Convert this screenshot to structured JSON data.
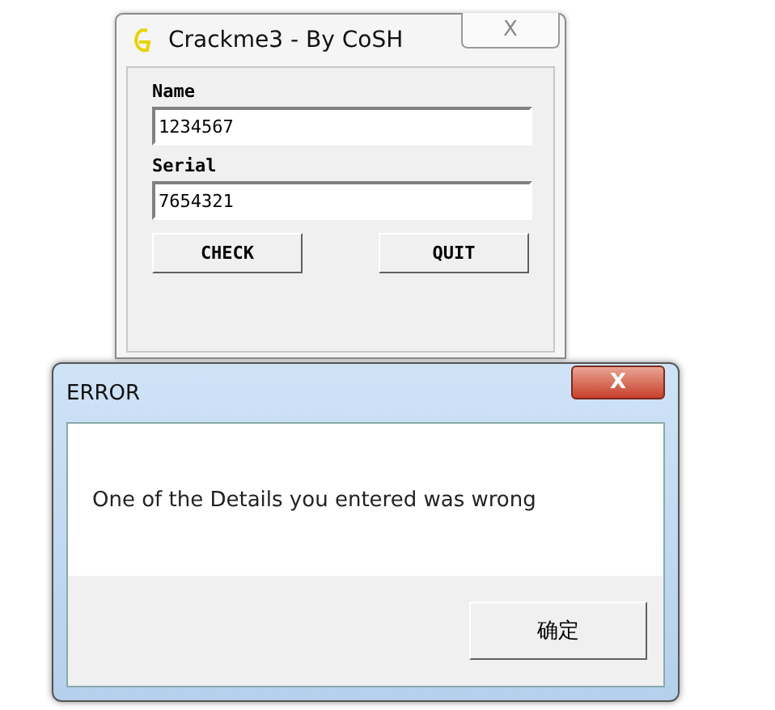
{
  "crackme_window": {
    "title": "Crackme3 - By CoSH",
    "close": "X",
    "fields": [
      {
        "label": "Name",
        "value": "1234567"
      },
      {
        "label": "Serial",
        "value": "7654321"
      }
    ],
    "buttons": [
      "CHECK",
      "QUIT"
    ]
  },
  "error_dialog": {
    "title": "ERROR",
    "close": "X",
    "message": "One of the Details you entered was wrong",
    "button": "确定"
  }
}
